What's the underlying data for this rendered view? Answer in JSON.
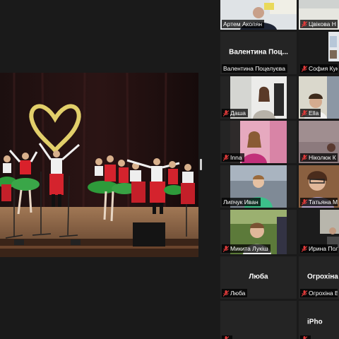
{
  "participants": [
    {
      "name": "Артем Акопян",
      "display_name": "",
      "video": true,
      "active": true
    },
    {
      "name": "Цвікова Н",
      "display_name": "",
      "video": true
    },
    {
      "name": "Валентина Поцелуєва",
      "display_name": "Валентина  Поц...",
      "video": false
    },
    {
      "name": "София Кук",
      "display_name": "",
      "video": true
    },
    {
      "name": "Даша",
      "display_name": "",
      "video": true
    },
    {
      "name": "Ella",
      "display_name": "",
      "video": true
    },
    {
      "name": "Inna",
      "display_name": "",
      "video": true
    },
    {
      "name": "Ніколюк К",
      "display_name": "",
      "video": true
    },
    {
      "name": "Липчук Иван",
      "display_name": "",
      "video": true
    },
    {
      "name": "Татьяна М",
      "display_name": "",
      "video": true
    },
    {
      "name": "Микита Лукіш",
      "display_name": "",
      "video": true
    },
    {
      "name": "Ирина Пол",
      "display_name": "",
      "video": true
    },
    {
      "name": "Люба",
      "display_name": "Люба",
      "video": false
    },
    {
      "name": "Огрохіна В",
      "display_name": "Огрохіна",
      "video": false
    },
    {
      "name": "",
      "display_name": "",
      "video": false
    },
    {
      "name": "",
      "display_name": "iPho",
      "video": false
    }
  ],
  "colors": {
    "active_border": "#b8e040",
    "muted_mic": "#e03a3a",
    "tile_bg": "#242424",
    "app_bg": "#1a1a1a"
  },
  "icons": {
    "muted": "muted-mic-icon"
  }
}
